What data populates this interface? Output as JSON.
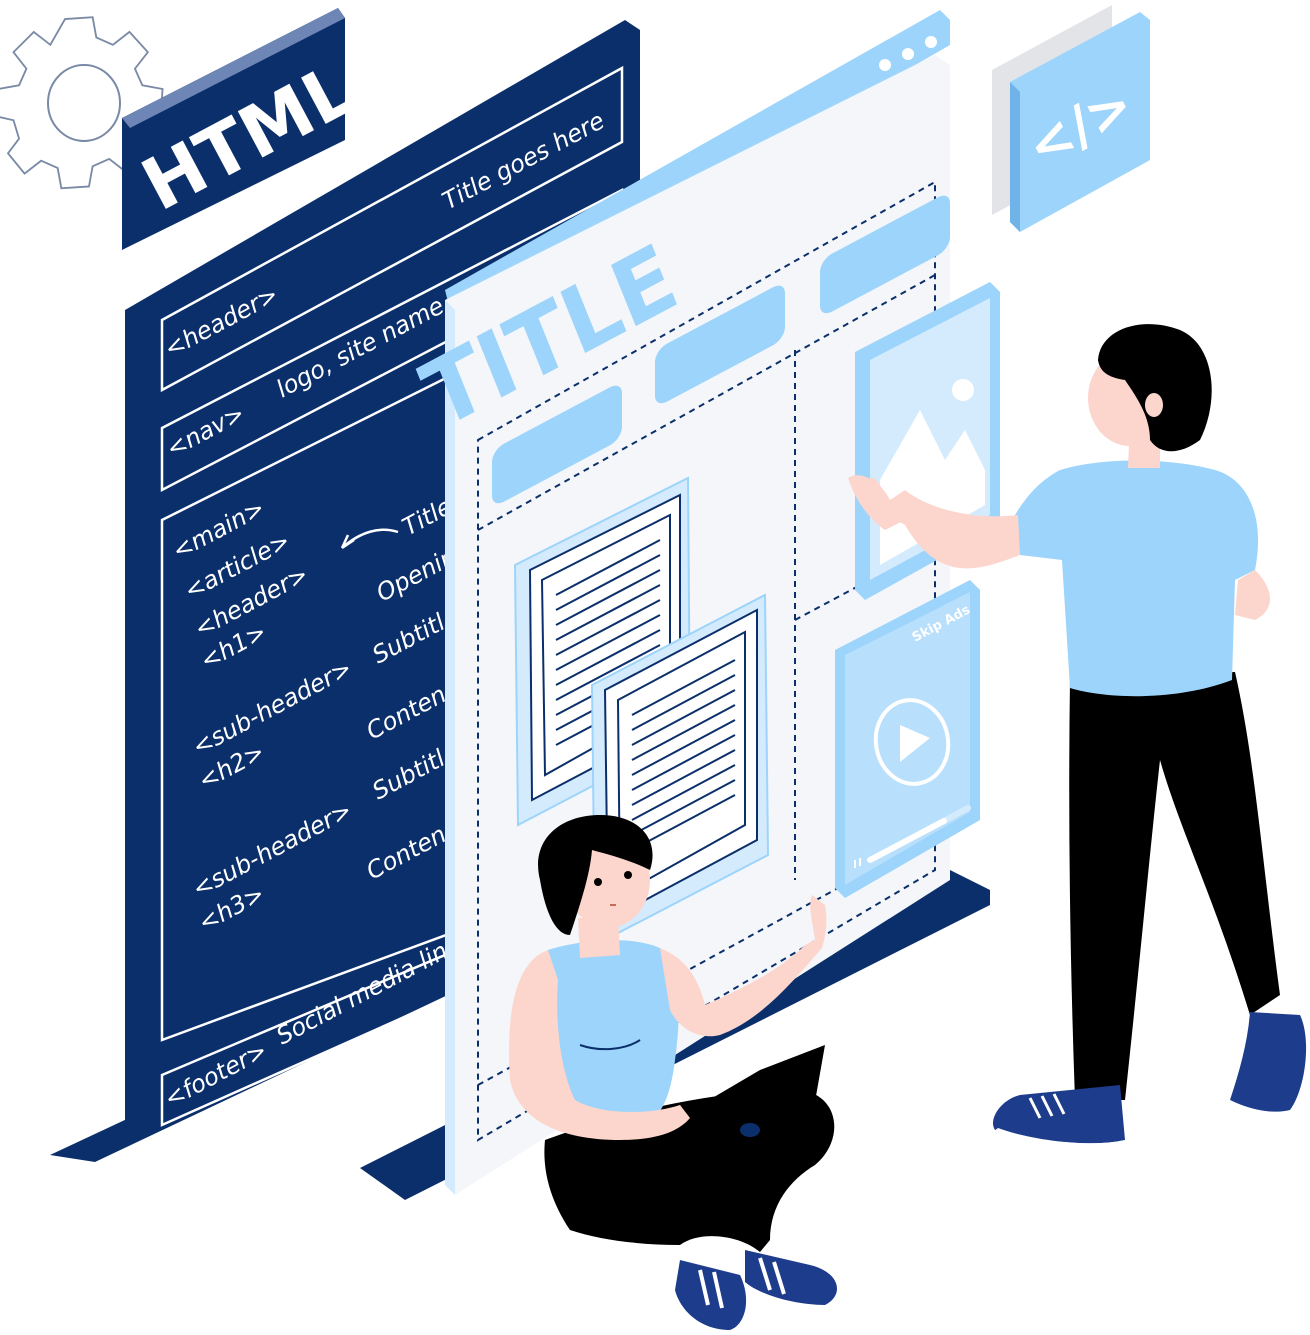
{
  "colors": {
    "navy": "#0b2f6b",
    "light_blue": "#9dd4fb",
    "pale_blue": "#d4ebfd",
    "panel_white": "#f4f6fa",
    "skin": "#fcd6cd",
    "black": "#000000",
    "gear": "#7a8aa6"
  },
  "html_panel": {
    "label": "HTML",
    "title_note": "Title goes here",
    "header_tag": "<header>",
    "header_note": "logo, site name,",
    "nav_tag": "<nav>",
    "main_tags": [
      "<main>",
      "<article>",
      "<header>",
      "<h1>",
      "<sub-header>",
      "<h2>",
      "<sub-header>",
      "<h3>"
    ],
    "main_notes": [
      "Title",
      "Openin",
      "Subtitl",
      "Conten",
      "Subtitl",
      "Conten"
    ],
    "social_note": "Social media links",
    "footer_tag": "<footer>"
  },
  "layout_panel": {
    "title": "TITLE"
  },
  "code_badge": {
    "icon": "code-brackets-icon",
    "text": "</>"
  },
  "video_card": {
    "skip_label": "Skip Ads",
    "progress": 0.75
  },
  "icons": [
    "gear-icon",
    "image-icon",
    "play-icon",
    "browser-dots-icon",
    "document-icon"
  ]
}
